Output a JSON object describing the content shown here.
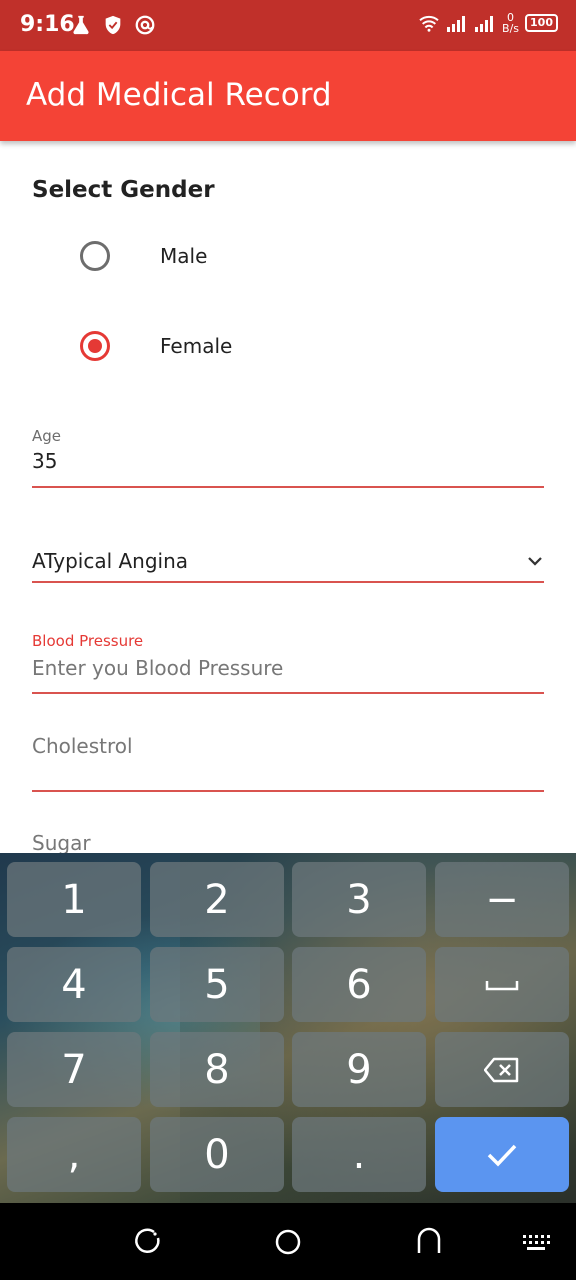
{
  "status_bar": {
    "time": "9:16",
    "net_speed_value": "0",
    "net_speed_unit": "B/s",
    "battery": "100",
    "icons": [
      "lab-flask-icon",
      "shield-icon",
      "at-circle-icon",
      "wifi-icon",
      "signal-icon",
      "signal-icon",
      "battery-icon"
    ]
  },
  "app_bar": {
    "title": "Add Medical Record",
    "color": "#f44336"
  },
  "form": {
    "gender_heading": "Select Gender",
    "gender_options": [
      {
        "label": "Male",
        "selected": false
      },
      {
        "label": "Female",
        "selected": true
      }
    ],
    "age": {
      "label": "Age",
      "value": "35"
    },
    "chest_pain": {
      "value": "ATypical Angina"
    },
    "blood_pressure": {
      "label": "Blood Pressure",
      "placeholder": "Enter you Blood Pressure"
    },
    "cholesterol": {
      "placeholder": "Cholestrol"
    },
    "sugar": {
      "placeholder": "Sugar"
    }
  },
  "keyboard": {
    "keys": [
      "1",
      "2",
      "3",
      "−",
      "4",
      "5",
      "6",
      "␣",
      "7",
      "8",
      "9",
      "⌫",
      ",",
      "0",
      ".",
      "✓"
    ],
    "confirm_color": "#5b95f0"
  },
  "nav_bar": {
    "icons": [
      "recent-apps-icon",
      "home-icon",
      "back-icon",
      "keyboard-switch-icon"
    ]
  }
}
